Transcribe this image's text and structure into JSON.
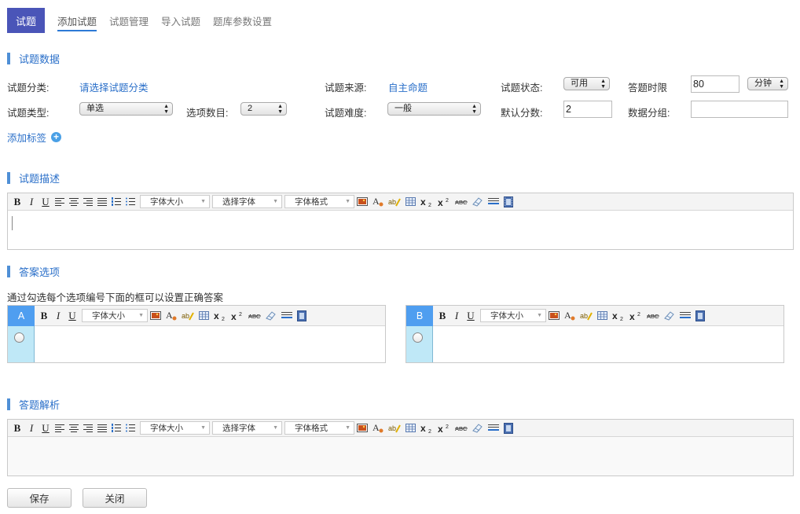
{
  "nav": {
    "active_tab": "试题",
    "links": [
      "添加试题",
      "试题管理",
      "导入试题",
      "题库参数设置"
    ]
  },
  "sections": {
    "data": "试题数据",
    "description": "试题描述",
    "answers": "答案选项",
    "analysis": "答题解析"
  },
  "form": {
    "category_label": "试题分类:",
    "category_value": "请选择试题分类",
    "source_label": "试题来源:",
    "source_value": "自主命题",
    "status_label": "试题状态:",
    "status_value": "可用",
    "time_limit_label": "答题时限",
    "time_limit_value": "80",
    "time_unit_value": "分钟",
    "type_label": "试题类型:",
    "type_value": "单选",
    "option_count_label": "选项数目:",
    "option_count_value": "2",
    "difficulty_label": "试题难度:",
    "difficulty_value": "一般",
    "default_score_label": "默认分数:",
    "default_score_value": "2",
    "data_group_label": "数据分组:",
    "data_group_value": ""
  },
  "add_tag": "添加标签",
  "editor": {
    "bold": "B",
    "italic": "I",
    "underline": "U",
    "font_size": "字体大小",
    "font_family": "选择字体",
    "font_format": "字体格式"
  },
  "answers_hint": "通过勾选每个选项编号下面的框可以设置正确答案",
  "options": [
    {
      "letter": "A"
    },
    {
      "letter": "B"
    }
  ],
  "buttons": {
    "save": "保存",
    "close": "关闭"
  },
  "colors": {
    "accent": "#4a55b8",
    "link": "#2a6fc9",
    "option_header": "#4f9ef0",
    "option_column": "#bfe8f7"
  }
}
